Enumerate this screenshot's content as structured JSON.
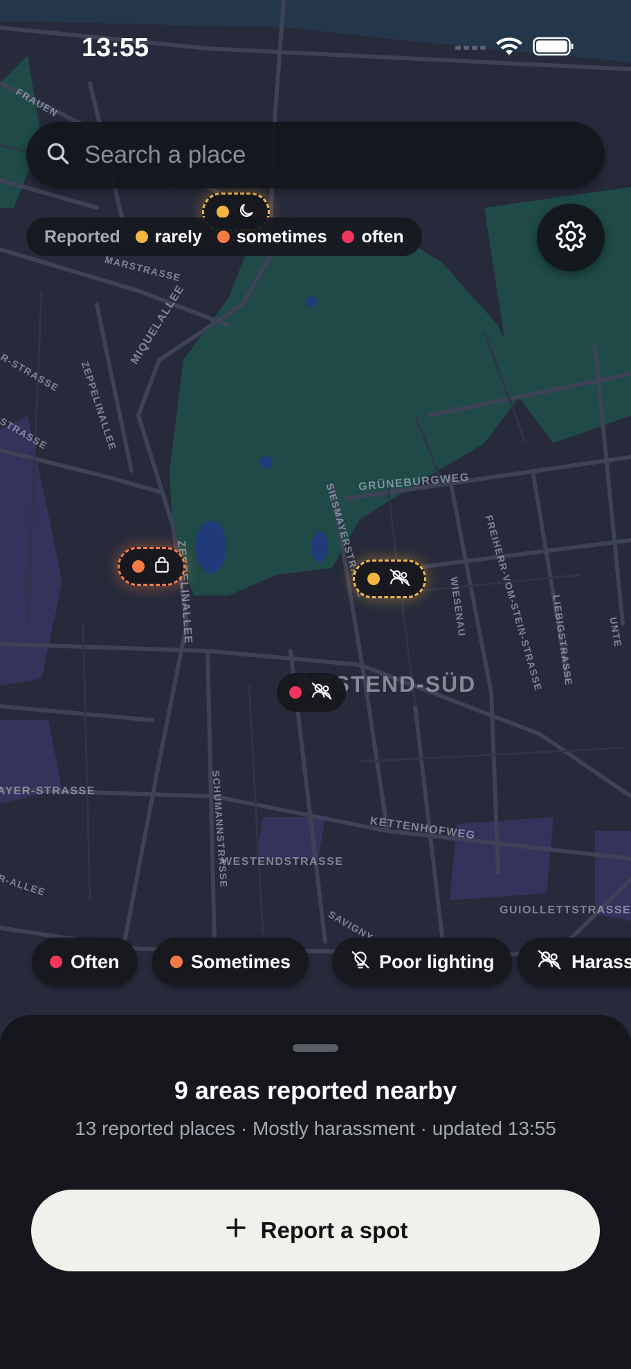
{
  "status_bar": {
    "time": "13:55"
  },
  "search": {
    "placeholder": "Search a place"
  },
  "legend": {
    "label": "Reported",
    "items": [
      {
        "label": "rarely",
        "color": "#f4b63f"
      },
      {
        "label": "sometimes",
        "color": "#f47c44"
      },
      {
        "label": "often",
        "color": "#f0365c"
      }
    ]
  },
  "map": {
    "streets": [
      "Miquelallee",
      "Zeppelinallee",
      "Zeppelinallee",
      "Grüneburgweg",
      "Siesmayerstraße",
      "Wiesenau",
      "Freiherr-vom-Stein-Straße",
      "Liebigstraße",
      "Schumannstraße",
      "Westendstraße",
      "Kettenhofweg",
      "Guiollettstraße",
      "Savigny",
      "Marstraße",
      "Frauen",
      "R-Straße",
      "Straße",
      "Ayer-Straße",
      "R-Allee",
      "Unte"
    ],
    "district": "WESTEND-SÜD"
  },
  "markers": [
    {
      "level": "rarely",
      "color": "#f4b63f",
      "icon": "moon-icon"
    },
    {
      "level": "sometimes",
      "color": "#f47c44",
      "icon": "shopping-bag-icon"
    },
    {
      "level": "rarely",
      "color": "#f4b63f",
      "icon": "harassment-icon"
    },
    {
      "level": "often",
      "color": "#f0365c",
      "icon": "harassment-icon"
    }
  ],
  "filters": [
    {
      "label": "Often",
      "color": "#f0365c"
    },
    {
      "label": "Sometimes",
      "color": "#f47c44"
    },
    {
      "label": "Poor lighting",
      "icon": "lightbulb-off-icon"
    },
    {
      "label": "Harass",
      "icon": "harassment-icon"
    }
  ],
  "sheet": {
    "title": "9 areas reported nearby",
    "subtitle": "13 reported places · Mostly harassment · updated 13:55",
    "report_button": "Report a spot"
  }
}
